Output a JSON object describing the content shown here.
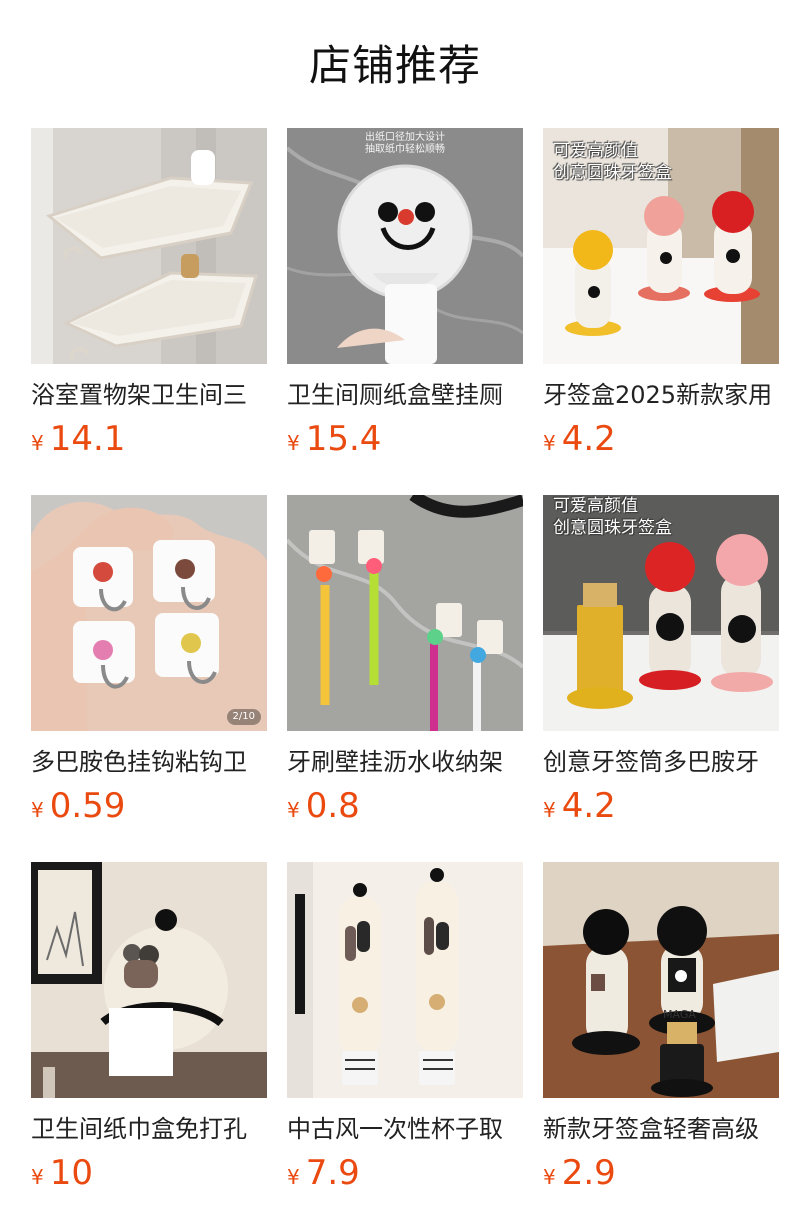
{
  "page": {
    "title": "店铺推荐"
  },
  "colors": {
    "price": "#ea4a0f",
    "text": "#222222",
    "background": "#ffffff"
  },
  "products": [
    {
      "name": "浴室置物架卫生间三",
      "currency": "¥",
      "price": "14.1",
      "image_icon": "shelf-product-image"
    },
    {
      "name": "卫生间厕纸盒壁挂厕",
      "currency": "¥",
      "price": "15.4",
      "image_icon": "tissue-box-product-image",
      "image_caption_1": "出纸口径加大设计",
      "image_caption_2": "抽取纸巾轻松顺畅"
    },
    {
      "name": "牙签盒2025新款家用",
      "currency": "¥",
      "price": "4.2",
      "image_icon": "toothpick-box-product-image",
      "image_overlay_1": "可爱高颜值",
      "image_overlay_2": "创意圆珠牙签盒"
    },
    {
      "name": "多巴胺色挂钩粘钩卫",
      "currency": "¥",
      "price": "0.59",
      "image_icon": "hooks-product-image",
      "image_indicator": "2/10"
    },
    {
      "name": "牙刷壁挂沥水收纳架",
      "currency": "¥",
      "price": "0.8",
      "image_icon": "toothbrush-holder-product-image"
    },
    {
      "name": "创意牙签筒多巴胺牙",
      "currency": "¥",
      "price": "4.2",
      "image_icon": "toothpick-holder-product-image",
      "image_overlay_1": "可爱高颜值",
      "image_overlay_2": "创意圆珠牙签盒"
    },
    {
      "name": "卫生间纸巾盒免打孔",
      "currency": "¥",
      "price": "10",
      "image_icon": "paper-towel-box-product-image"
    },
    {
      "name": "中古风一次性杯子取",
      "currency": "¥",
      "price": "7.9",
      "image_icon": "cup-dispenser-product-image"
    },
    {
      "name": "新款牙签盒轻奢高级",
      "currency": "¥",
      "price": "2.9",
      "image_icon": "luxury-toothpick-box-product-image",
      "image_label": "MAGA"
    }
  ]
}
